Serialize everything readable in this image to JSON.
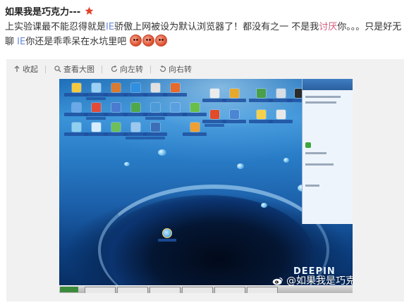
{
  "post": {
    "username": "如果我是巧克力---",
    "text_segments": [
      {
        "text": "上实验课最不能忍得就是",
        "style": "normal"
      },
      {
        "text": "IE",
        "style": "hl"
      },
      {
        "text": "骄傲上网被设为默认浏览器了！都没有之一 不是我",
        "style": "normal"
      },
      {
        "text": "讨厌",
        "style": "em"
      },
      {
        "text": "你。。。只是好无聊 ",
        "style": "normal"
      },
      {
        "text": "IE",
        "style": "hl"
      },
      {
        "text": "你还是乖乖呆在水坑里吧",
        "style": "normal"
      }
    ],
    "emoji_count": 3
  },
  "toolbar": {
    "collapse": "收起",
    "view_large": "查看大图",
    "rotate_left": "向左转",
    "rotate_right": "向右转"
  },
  "image": {
    "wallpaper_brand": "DEEPIN",
    "watermark": "@如果我是巧克力"
  },
  "colors": {
    "link_blue": "#6a8ad8",
    "emphasis_pink": "#d05f7d",
    "star_red": "#e2442b"
  }
}
